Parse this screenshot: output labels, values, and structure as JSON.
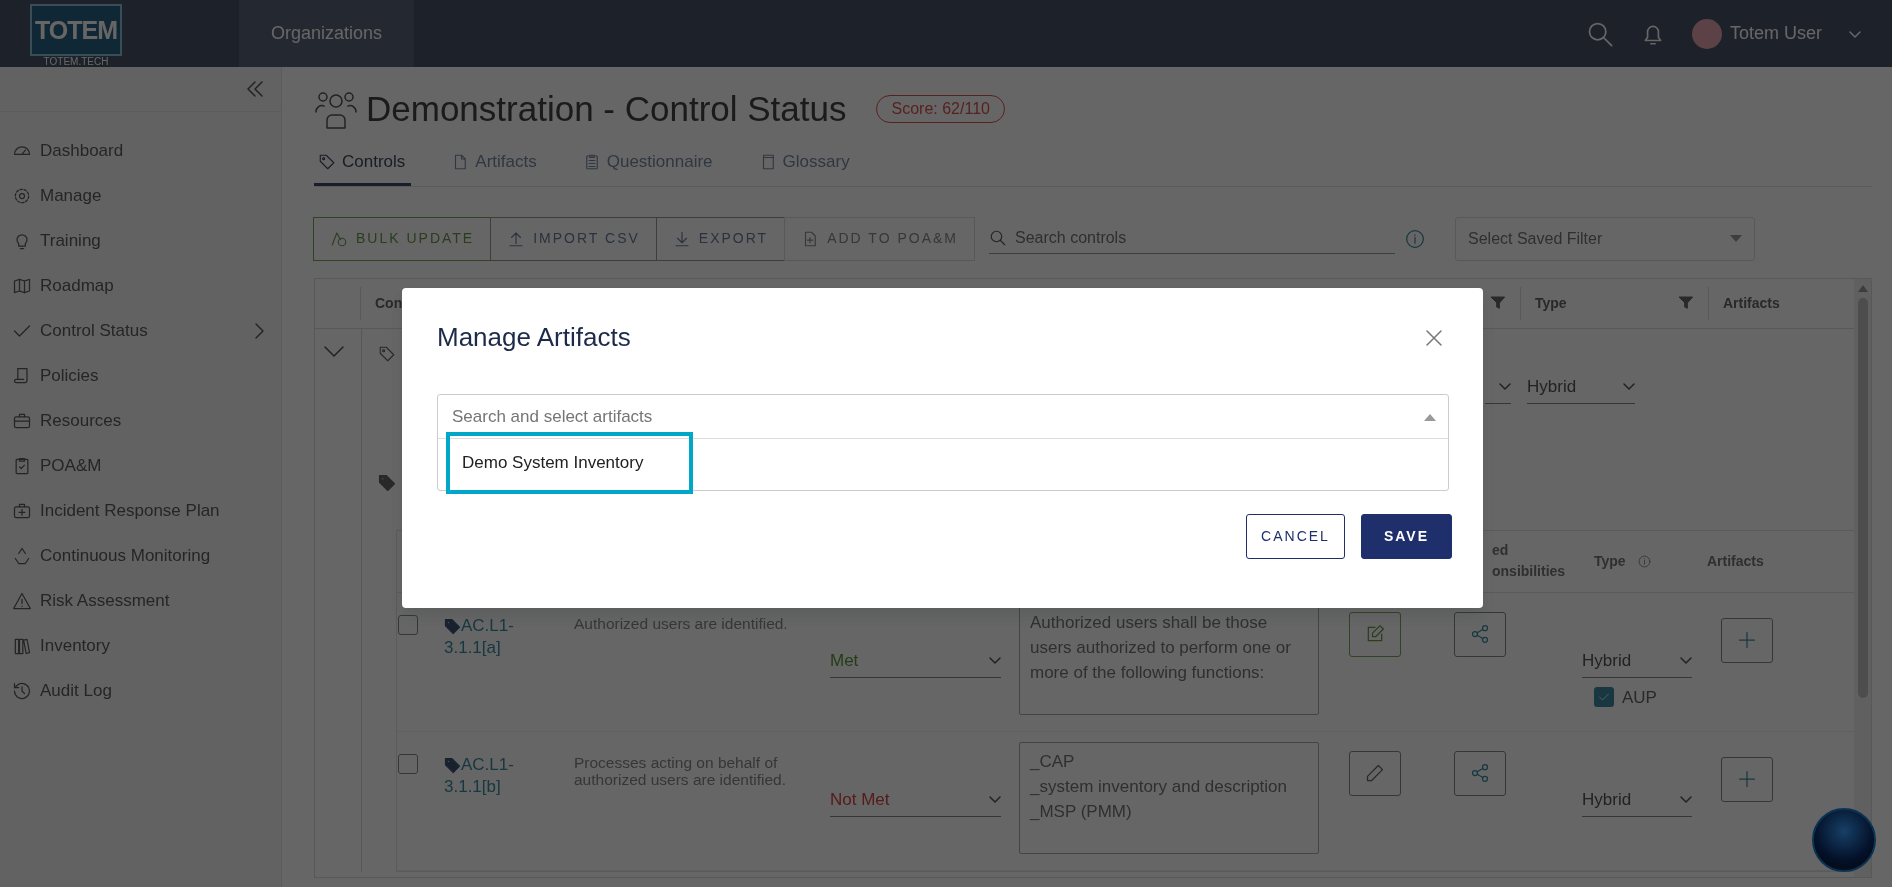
{
  "topbar": {
    "logo_text": "TOTEM",
    "logo_subtext": "TOTEM.TECH",
    "nav": [
      {
        "label": "Organizations"
      }
    ],
    "user": "Totem User"
  },
  "sidebar": {
    "items": [
      {
        "label": "Dashboard",
        "expandable": false
      },
      {
        "label": "Manage",
        "expandable": false
      },
      {
        "label": "Training",
        "expandable": false
      },
      {
        "label": "Roadmap",
        "expandable": false
      },
      {
        "label": "Control Status",
        "expandable": true
      },
      {
        "label": "Policies",
        "expandable": false
      },
      {
        "label": "Resources",
        "expandable": false
      },
      {
        "label": "POA&M",
        "expandable": false
      },
      {
        "label": "Incident Response Plan",
        "expandable": false
      },
      {
        "label": "Continuous Monitoring",
        "expandable": false
      },
      {
        "label": "Risk Assessment",
        "expandable": false
      },
      {
        "label": "Inventory",
        "expandable": false
      },
      {
        "label": "Audit Log",
        "expandable": false
      }
    ]
  },
  "page": {
    "title": "Demonstration - Control Status",
    "score": "Score: 62/110"
  },
  "tabs": [
    {
      "label": "Controls",
      "selected": true
    },
    {
      "label": "Artifacts",
      "selected": false
    },
    {
      "label": "Questionnaire",
      "selected": false
    },
    {
      "label": "Glossary",
      "selected": false
    }
  ],
  "toolbar": {
    "buttons": [
      {
        "label": "BULK UPDATE",
        "kind": "success",
        "disabled": false
      },
      {
        "label": "IMPORT CSV",
        "kind": "plain",
        "disabled": false
      },
      {
        "label": "EXPORT",
        "kind": "plain",
        "disabled": false
      },
      {
        "label": "ADD TO POA&M",
        "kind": "plain",
        "disabled": true
      }
    ],
    "search": {
      "placeholder": "Search controls"
    },
    "saved_filter": {
      "placeholder": "Select Saved Filter"
    }
  },
  "table": {
    "columns": [
      "Con",
      "Type",
      "Artifacts"
    ],
    "group": {
      "type": "Hybrid",
      "expanded": true
    },
    "inner_columns": [
      {
        "line1": "ed",
        "line2": "onsibilities"
      },
      {
        "line1": "Type"
      },
      {
        "line1": "Artifacts"
      }
    ],
    "rows": [
      {
        "id": "AC.L1-3.1.1[a]",
        "description": "Authorized users are identified.",
        "checked": false,
        "status": {
          "label": "Met",
          "kind": "met"
        },
        "notes": "Authorized users shall be those users authorized to perform one or more of the following functions:",
        "edited": true,
        "type": "Hybrid",
        "aup": {
          "label": "AUP",
          "checked": true
        }
      },
      {
        "id": "AC.L1-3.1.1[b]",
        "description": "Processes acting on behalf of authorized users are identified.",
        "checked": false,
        "status": {
          "label": "Not Met",
          "kind": "not_met"
        },
        "notes": "_CAP\n_system inventory and description\n_MSP (PMM)",
        "edited": false,
        "type": "Hybrid"
      }
    ]
  },
  "modal": {
    "title": "Manage Artifacts",
    "select": {
      "placeholder": "Search and select artifacts",
      "expanded": true,
      "options": [
        {
          "label": "Demo System Inventory",
          "highlighted": true
        }
      ]
    },
    "buttons": [
      {
        "label": "CANCEL",
        "kind": "outline"
      },
      {
        "label": "SAVE",
        "kind": "primary"
      }
    ]
  }
}
